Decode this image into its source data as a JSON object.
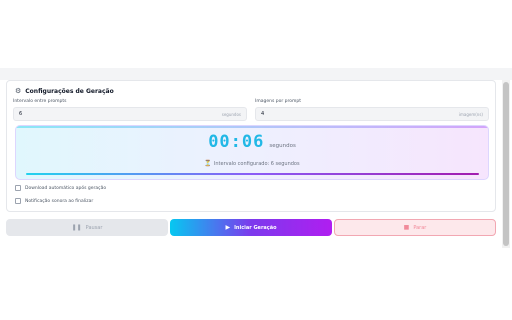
{
  "panel": {
    "title": "Configurações de Geração",
    "interval": {
      "label": "Intervalo entre prompts",
      "value": "6",
      "suffix": "segundos"
    },
    "images": {
      "label": "Imagens por prompt",
      "value": "4",
      "suffix": "imagem(ns)"
    }
  },
  "timer": {
    "value": "00:06",
    "unit": "segundos",
    "info": "Intervalo configurado: 6 segundos",
    "progress": 1.0
  },
  "options": {
    "auto_download": "Download automático após geração",
    "sound_notification": "Notificação sonora ao finalizar"
  },
  "buttons": {
    "pause": "Pausar",
    "start": "Iniciar Geração",
    "stop": "Parar"
  },
  "icons": {
    "settings": "gear-icon",
    "hourglass": "hourglass-icon",
    "pause": "pause-icon",
    "start": "play-icon",
    "stop": "stop-icon"
  },
  "colors": {
    "timer": "#22b8e6",
    "start_gradient": [
      "#06c8f0",
      "#7c3aed",
      "#b01ef0"
    ],
    "stop_bg": "#fde8eb"
  }
}
